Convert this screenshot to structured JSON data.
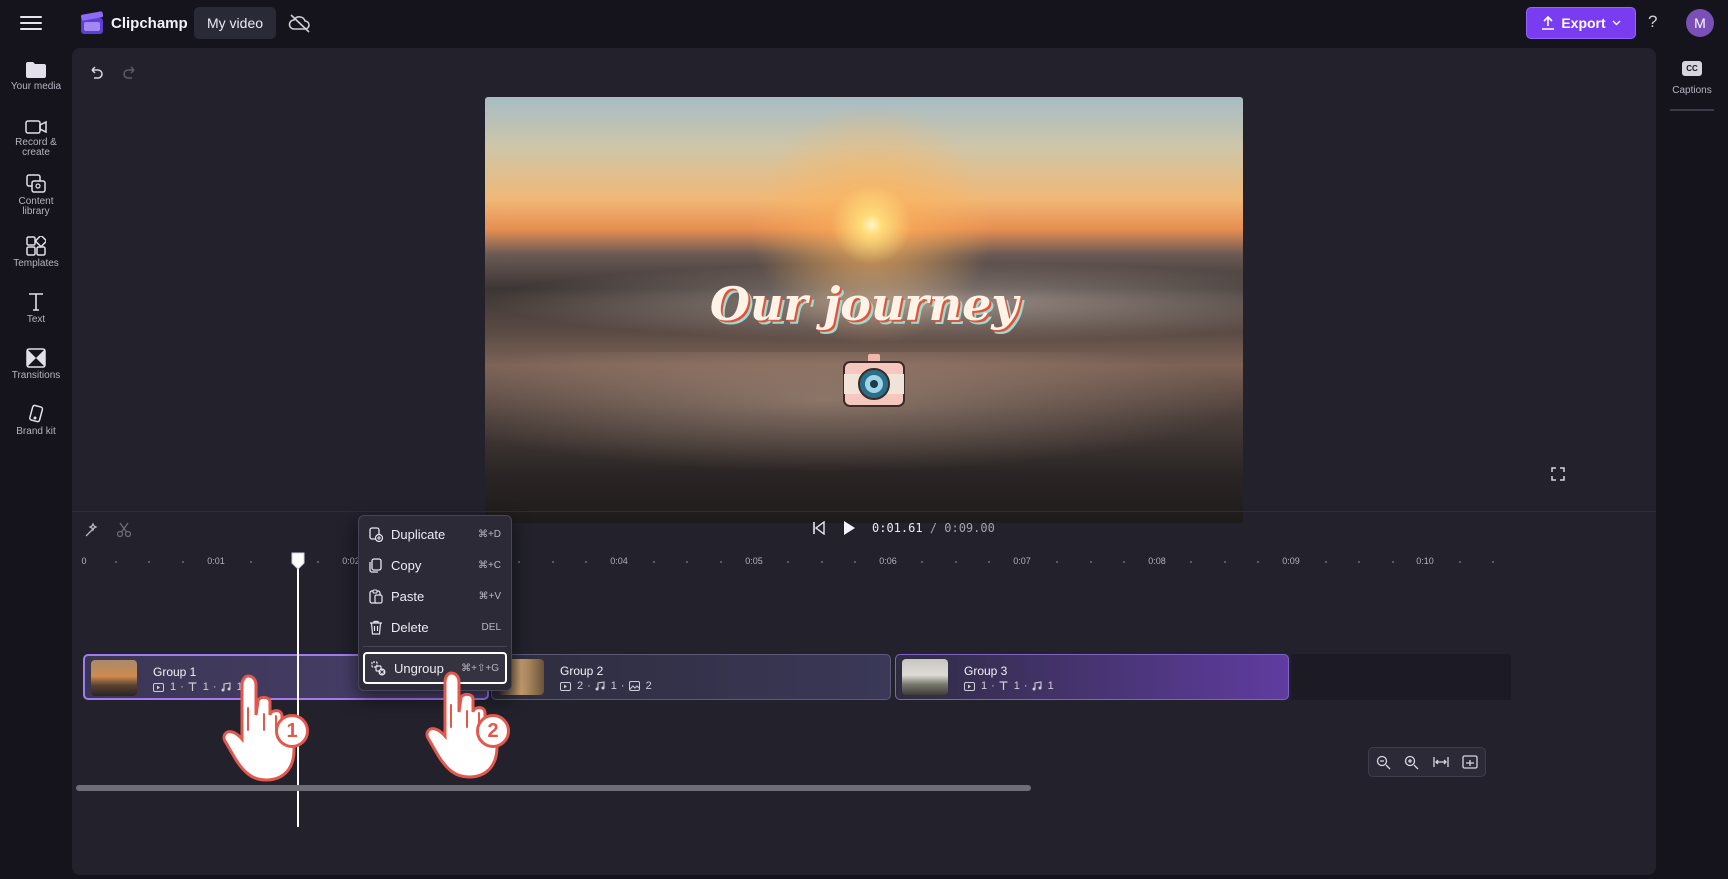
{
  "app": {
    "name": "Clipchamp",
    "project": "My video"
  },
  "header": {
    "export_label": "Export",
    "help_label": "?",
    "avatar_initial": "M"
  },
  "sidebar": {
    "items": [
      {
        "label": "Your media",
        "icon": "folder-icon"
      },
      {
        "label": "Record &",
        "label2": "create",
        "icon": "camera-record-icon"
      },
      {
        "label": "Content",
        "label2": "library",
        "icon": "content-library-icon"
      },
      {
        "label": "Templates",
        "icon": "templates-icon"
      },
      {
        "label": "Text",
        "icon": "text-icon"
      },
      {
        "label": "Transitions",
        "icon": "transitions-icon"
      },
      {
        "label": "Brand kit",
        "icon": "brand-kit-icon"
      }
    ]
  },
  "rightbar": {
    "captions_label": "Captions",
    "cc_glyph": "CC"
  },
  "preview": {
    "title_text": "Our journey"
  },
  "transport": {
    "current_time": "0:01.61",
    "total_time": "/ 0:09.00"
  },
  "ruler": {
    "labels": [
      "0",
      "0:01",
      "0:02",
      "0:04",
      "0:05",
      "0:06",
      "0:07",
      "0:08",
      "0:09",
      "0:10"
    ]
  },
  "timeline": {
    "groups": [
      {
        "name": "Group 1",
        "video": "1",
        "text": "1",
        "audio": "1"
      },
      {
        "name": "Group 2",
        "video": "2",
        "audio": "1",
        "image": "2"
      },
      {
        "name": "Group 3",
        "video": "1",
        "text": "1",
        "audio": "1"
      }
    ]
  },
  "context_menu": {
    "items": [
      {
        "label": "Duplicate",
        "shortcut": "⌘+D",
        "icon": "duplicate-icon"
      },
      {
        "label": "Copy",
        "shortcut": "⌘+C",
        "icon": "copy-icon"
      },
      {
        "label": "Paste",
        "shortcut": "⌘+V",
        "icon": "paste-icon"
      },
      {
        "label": "Delete",
        "shortcut": "DEL",
        "icon": "trash-icon"
      },
      {
        "label": "Ungroup",
        "shortcut": "⌘+⇧+G",
        "icon": "ungroup-icon"
      }
    ]
  },
  "annotations": {
    "step1": "1",
    "step2": "2"
  },
  "colors": {
    "accent": "#7a3cf0",
    "badge": "#e4574d",
    "selection": "#a07cf0"
  }
}
